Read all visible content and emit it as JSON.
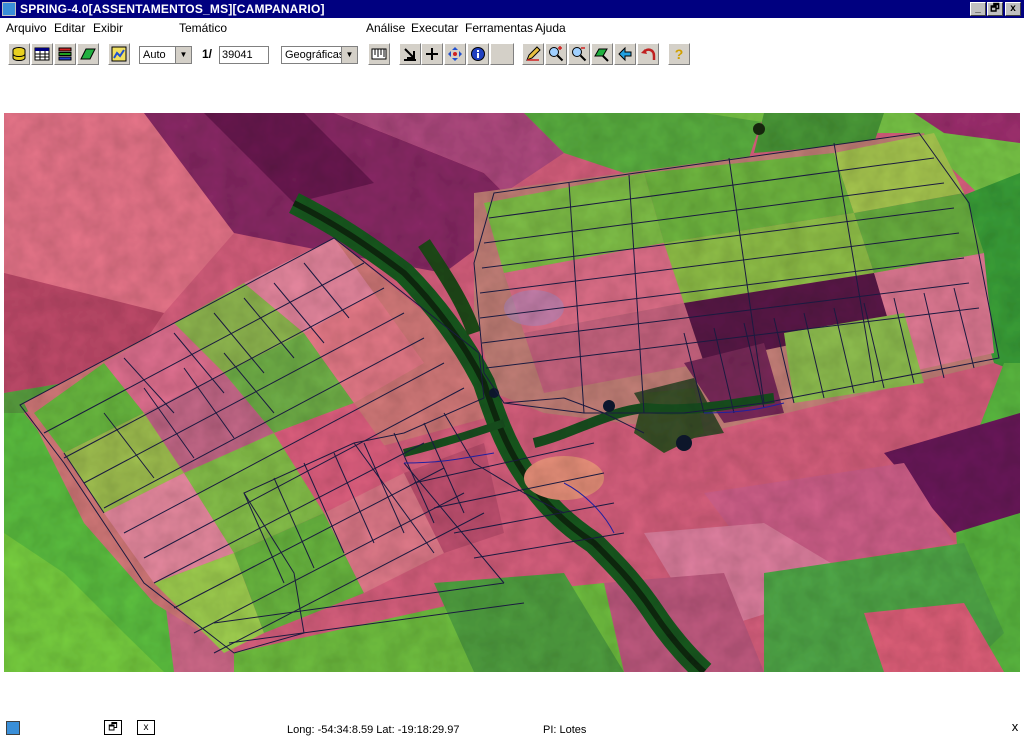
{
  "window": {
    "title": "SPRING-4.0[ASSENTAMENTOS_MS][CAMPANARIO]",
    "minimize": "_",
    "restore": "🗗",
    "close": "x"
  },
  "menu": {
    "arquivo": "Arquivo",
    "editar": "Editar",
    "exibir": "Exibir",
    "tematico": "Temático",
    "analise": "Análise",
    "executar": "Executar",
    "ferramentas": "Ferramentas",
    "ajuda": "Ajuda"
  },
  "toolbar": {
    "zoom_mode": "Auto",
    "scale_prefix": "1/",
    "scale_value": "39041",
    "projection": "Geográficas",
    "help": "?"
  },
  "map": {
    "field_label": "Lotes"
  },
  "status": {
    "coordinates": "Long: -54:34:8.59 Lat: -19:18:29.97",
    "plan_info": "PI: Lotes",
    "restore": "🗗",
    "close": "x",
    "app_close": "x"
  },
  "colors": {
    "titlebar": "#000080",
    "field_pink": "#e0607a",
    "field_green": "#5ab53a",
    "field_magenta": "#a0306a",
    "river": "#1a4a20",
    "plot_lines": "#1a1a3a"
  }
}
